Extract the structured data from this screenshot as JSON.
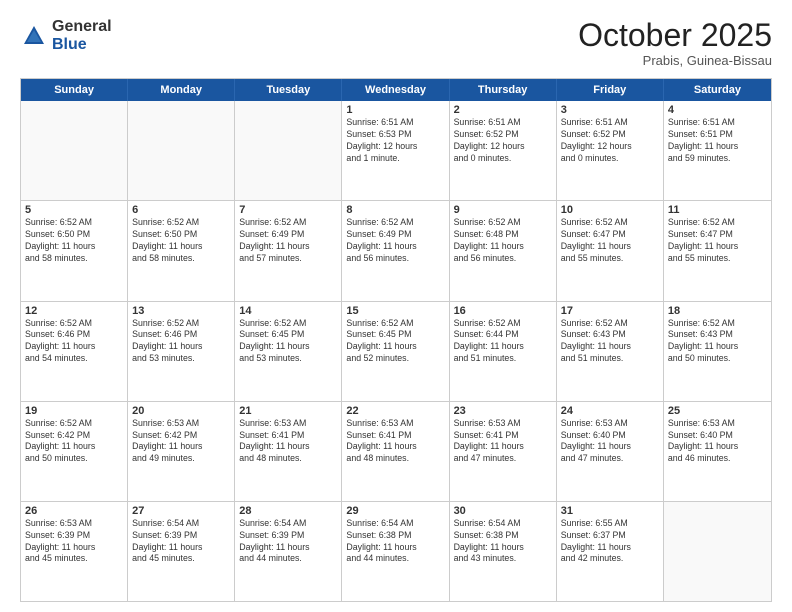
{
  "header": {
    "logo": {
      "general": "General",
      "blue": "Blue"
    },
    "title": "October 2025",
    "location": "Prabis, Guinea-Bissau"
  },
  "weekdays": [
    "Sunday",
    "Monday",
    "Tuesday",
    "Wednesday",
    "Thursday",
    "Friday",
    "Saturday"
  ],
  "weeks": [
    [
      {
        "day": "",
        "lines": []
      },
      {
        "day": "",
        "lines": []
      },
      {
        "day": "",
        "lines": []
      },
      {
        "day": "1",
        "lines": [
          "Sunrise: 6:51 AM",
          "Sunset: 6:53 PM",
          "Daylight: 12 hours",
          "and 1 minute."
        ]
      },
      {
        "day": "2",
        "lines": [
          "Sunrise: 6:51 AM",
          "Sunset: 6:52 PM",
          "Daylight: 12 hours",
          "and 0 minutes."
        ]
      },
      {
        "day": "3",
        "lines": [
          "Sunrise: 6:51 AM",
          "Sunset: 6:52 PM",
          "Daylight: 12 hours",
          "and 0 minutes."
        ]
      },
      {
        "day": "4",
        "lines": [
          "Sunrise: 6:51 AM",
          "Sunset: 6:51 PM",
          "Daylight: 11 hours",
          "and 59 minutes."
        ]
      }
    ],
    [
      {
        "day": "5",
        "lines": [
          "Sunrise: 6:52 AM",
          "Sunset: 6:50 PM",
          "Daylight: 11 hours",
          "and 58 minutes."
        ]
      },
      {
        "day": "6",
        "lines": [
          "Sunrise: 6:52 AM",
          "Sunset: 6:50 PM",
          "Daylight: 11 hours",
          "and 58 minutes."
        ]
      },
      {
        "day": "7",
        "lines": [
          "Sunrise: 6:52 AM",
          "Sunset: 6:49 PM",
          "Daylight: 11 hours",
          "and 57 minutes."
        ]
      },
      {
        "day": "8",
        "lines": [
          "Sunrise: 6:52 AM",
          "Sunset: 6:49 PM",
          "Daylight: 11 hours",
          "and 56 minutes."
        ]
      },
      {
        "day": "9",
        "lines": [
          "Sunrise: 6:52 AM",
          "Sunset: 6:48 PM",
          "Daylight: 11 hours",
          "and 56 minutes."
        ]
      },
      {
        "day": "10",
        "lines": [
          "Sunrise: 6:52 AM",
          "Sunset: 6:47 PM",
          "Daylight: 11 hours",
          "and 55 minutes."
        ]
      },
      {
        "day": "11",
        "lines": [
          "Sunrise: 6:52 AM",
          "Sunset: 6:47 PM",
          "Daylight: 11 hours",
          "and 55 minutes."
        ]
      }
    ],
    [
      {
        "day": "12",
        "lines": [
          "Sunrise: 6:52 AM",
          "Sunset: 6:46 PM",
          "Daylight: 11 hours",
          "and 54 minutes."
        ]
      },
      {
        "day": "13",
        "lines": [
          "Sunrise: 6:52 AM",
          "Sunset: 6:46 PM",
          "Daylight: 11 hours",
          "and 53 minutes."
        ]
      },
      {
        "day": "14",
        "lines": [
          "Sunrise: 6:52 AM",
          "Sunset: 6:45 PM",
          "Daylight: 11 hours",
          "and 53 minutes."
        ]
      },
      {
        "day": "15",
        "lines": [
          "Sunrise: 6:52 AM",
          "Sunset: 6:45 PM",
          "Daylight: 11 hours",
          "and 52 minutes."
        ]
      },
      {
        "day": "16",
        "lines": [
          "Sunrise: 6:52 AM",
          "Sunset: 6:44 PM",
          "Daylight: 11 hours",
          "and 51 minutes."
        ]
      },
      {
        "day": "17",
        "lines": [
          "Sunrise: 6:52 AM",
          "Sunset: 6:43 PM",
          "Daylight: 11 hours",
          "and 51 minutes."
        ]
      },
      {
        "day": "18",
        "lines": [
          "Sunrise: 6:52 AM",
          "Sunset: 6:43 PM",
          "Daylight: 11 hours",
          "and 50 minutes."
        ]
      }
    ],
    [
      {
        "day": "19",
        "lines": [
          "Sunrise: 6:52 AM",
          "Sunset: 6:42 PM",
          "Daylight: 11 hours",
          "and 50 minutes."
        ]
      },
      {
        "day": "20",
        "lines": [
          "Sunrise: 6:53 AM",
          "Sunset: 6:42 PM",
          "Daylight: 11 hours",
          "and 49 minutes."
        ]
      },
      {
        "day": "21",
        "lines": [
          "Sunrise: 6:53 AM",
          "Sunset: 6:41 PM",
          "Daylight: 11 hours",
          "and 48 minutes."
        ]
      },
      {
        "day": "22",
        "lines": [
          "Sunrise: 6:53 AM",
          "Sunset: 6:41 PM",
          "Daylight: 11 hours",
          "and 48 minutes."
        ]
      },
      {
        "day": "23",
        "lines": [
          "Sunrise: 6:53 AM",
          "Sunset: 6:41 PM",
          "Daylight: 11 hours",
          "and 47 minutes."
        ]
      },
      {
        "day": "24",
        "lines": [
          "Sunrise: 6:53 AM",
          "Sunset: 6:40 PM",
          "Daylight: 11 hours",
          "and 47 minutes."
        ]
      },
      {
        "day": "25",
        "lines": [
          "Sunrise: 6:53 AM",
          "Sunset: 6:40 PM",
          "Daylight: 11 hours",
          "and 46 minutes."
        ]
      }
    ],
    [
      {
        "day": "26",
        "lines": [
          "Sunrise: 6:53 AM",
          "Sunset: 6:39 PM",
          "Daylight: 11 hours",
          "and 45 minutes."
        ]
      },
      {
        "day": "27",
        "lines": [
          "Sunrise: 6:54 AM",
          "Sunset: 6:39 PM",
          "Daylight: 11 hours",
          "and 45 minutes."
        ]
      },
      {
        "day": "28",
        "lines": [
          "Sunrise: 6:54 AM",
          "Sunset: 6:39 PM",
          "Daylight: 11 hours",
          "and 44 minutes."
        ]
      },
      {
        "day": "29",
        "lines": [
          "Sunrise: 6:54 AM",
          "Sunset: 6:38 PM",
          "Daylight: 11 hours",
          "and 44 minutes."
        ]
      },
      {
        "day": "30",
        "lines": [
          "Sunrise: 6:54 AM",
          "Sunset: 6:38 PM",
          "Daylight: 11 hours",
          "and 43 minutes."
        ]
      },
      {
        "day": "31",
        "lines": [
          "Sunrise: 6:55 AM",
          "Sunset: 6:37 PM",
          "Daylight: 11 hours",
          "and 42 minutes."
        ]
      },
      {
        "day": "",
        "lines": []
      }
    ]
  ]
}
